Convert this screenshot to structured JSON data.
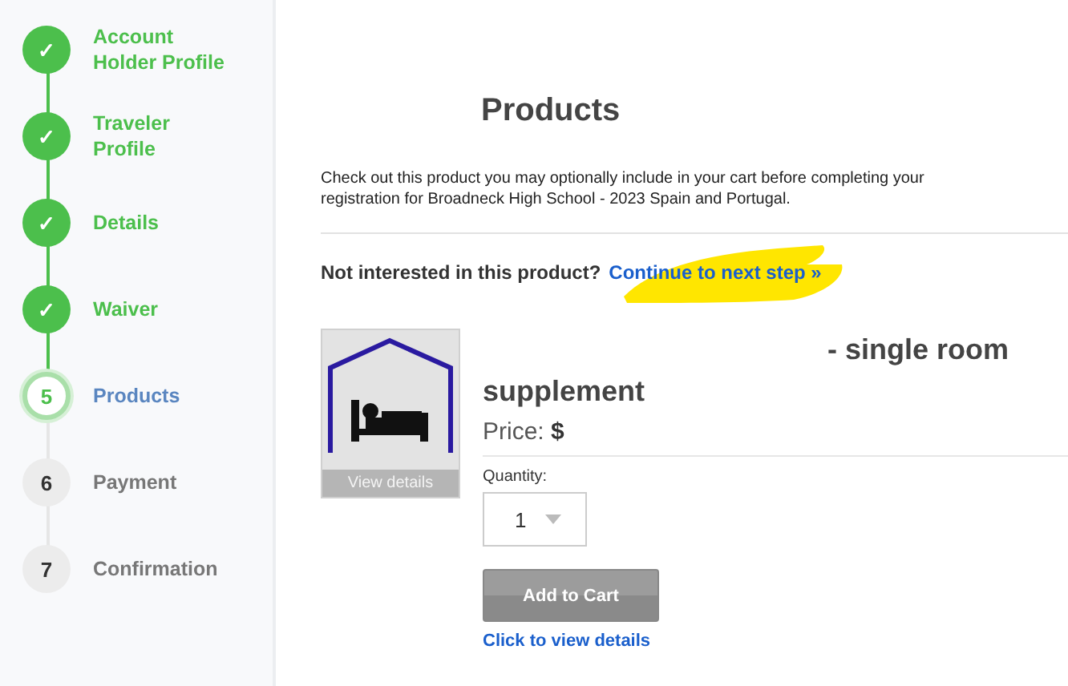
{
  "steps": [
    {
      "marker": "✓",
      "label": "Account Holder Profile",
      "kind": "done"
    },
    {
      "marker": "✓",
      "label": "Traveler Profile",
      "kind": "done"
    },
    {
      "marker": "✓",
      "label": "Details",
      "kind": "done"
    },
    {
      "marker": "✓",
      "label": "Waiver",
      "kind": "done"
    },
    {
      "marker": "5",
      "label": "Products",
      "kind": "current"
    },
    {
      "marker": "6",
      "label": "Payment",
      "kind": "pending"
    },
    {
      "marker": "7",
      "label": "Confirmation",
      "kind": "pending"
    }
  ],
  "title": "Products",
  "description": "Check out this product you may optionally include in your cart before completing your registration for Broadneck High School - 2023 Spain and Portugal.",
  "skip": {
    "question": "Not interested in this product?",
    "link": "Continue to next step »"
  },
  "product": {
    "image_caption": "View details",
    "name": "- single room supplement",
    "price": "Price: **$**",
    "quantity_label": "Quantity:",
    "quantity": "1",
    "add_button": "Add to Cart",
    "details_link": "Click to view details"
  }
}
